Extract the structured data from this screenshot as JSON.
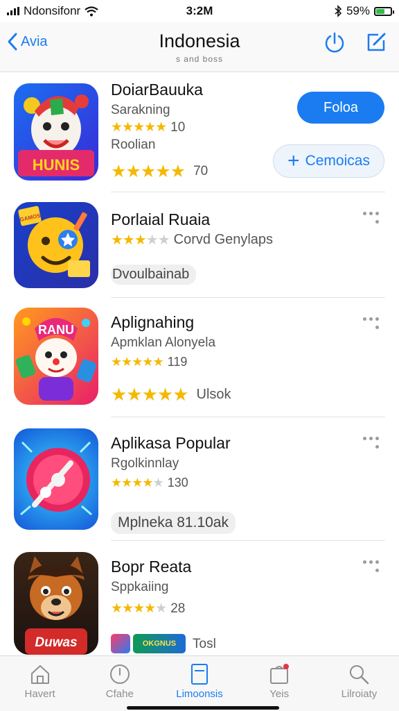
{
  "status_bar": {
    "carrier": "Ndonsifonr",
    "time": "3:2M",
    "battery": "59%",
    "battery_level": 0.59
  },
  "nav": {
    "back_label": "Avia",
    "title": "Indonesia",
    "subtitle": "s and boss"
  },
  "apps": [
    {
      "name": "DoiarBauuka",
      "subtitle": "Sarakning",
      "rating_small": "★★★★★",
      "count_small": "10",
      "label": "Roolian",
      "rating_large": "★★★★★",
      "count_large": "70",
      "primary_button": "Foloa",
      "secondary_button": "Cemoicas",
      "icon": "clown-game-icon",
      "icon_text": "HUNIS"
    },
    {
      "name": "Porlaial Ruaia",
      "rating": "★★★",
      "rating_off": "★★",
      "count": "Corvd Genylaps",
      "tag": "Dvoulbainab",
      "icon": "emoji-face-icon",
      "icon_text": "GAMOS"
    },
    {
      "name": "Aplignahing",
      "subtitle": "Apmklan Alonyela",
      "rating_small": "★★★★★",
      "count_small": "119",
      "rating_large": "★★★★★",
      "count_large": "Ulsok",
      "icon": "snowman-clown-icon",
      "icon_text": "RANU"
    },
    {
      "name": "Aplikasa Popular",
      "subtitle": "Rgolkinnlay",
      "rating": "★★★★",
      "rating_off": "★",
      "count": "130",
      "tag": "Mplneka 81.10ak",
      "icon": "music-disc-icon"
    },
    {
      "name": "Bopr Reata",
      "subtitle": "Sppkaiing",
      "rating": "★★★★",
      "rating_off": "★",
      "count": "28",
      "mini_label": "Tosl",
      "mini_icon_text": "OKGNUS",
      "icon": "wolf-character-icon",
      "icon_text": "Duwas"
    }
  ],
  "tabs": [
    {
      "label": "Havert",
      "icon": "home-icon"
    },
    {
      "label": "Cfahe",
      "icon": "clock-icon"
    },
    {
      "label": "Limoonsis",
      "icon": "apps-icon",
      "active": true
    },
    {
      "label": "Yeis",
      "icon": "bag-icon"
    },
    {
      "label": "Lilroiaty",
      "icon": "search-icon"
    }
  ],
  "colors": {
    "accent": "#1a7cf0",
    "star": "#f5b800",
    "battery": "#2fbd4a"
  }
}
